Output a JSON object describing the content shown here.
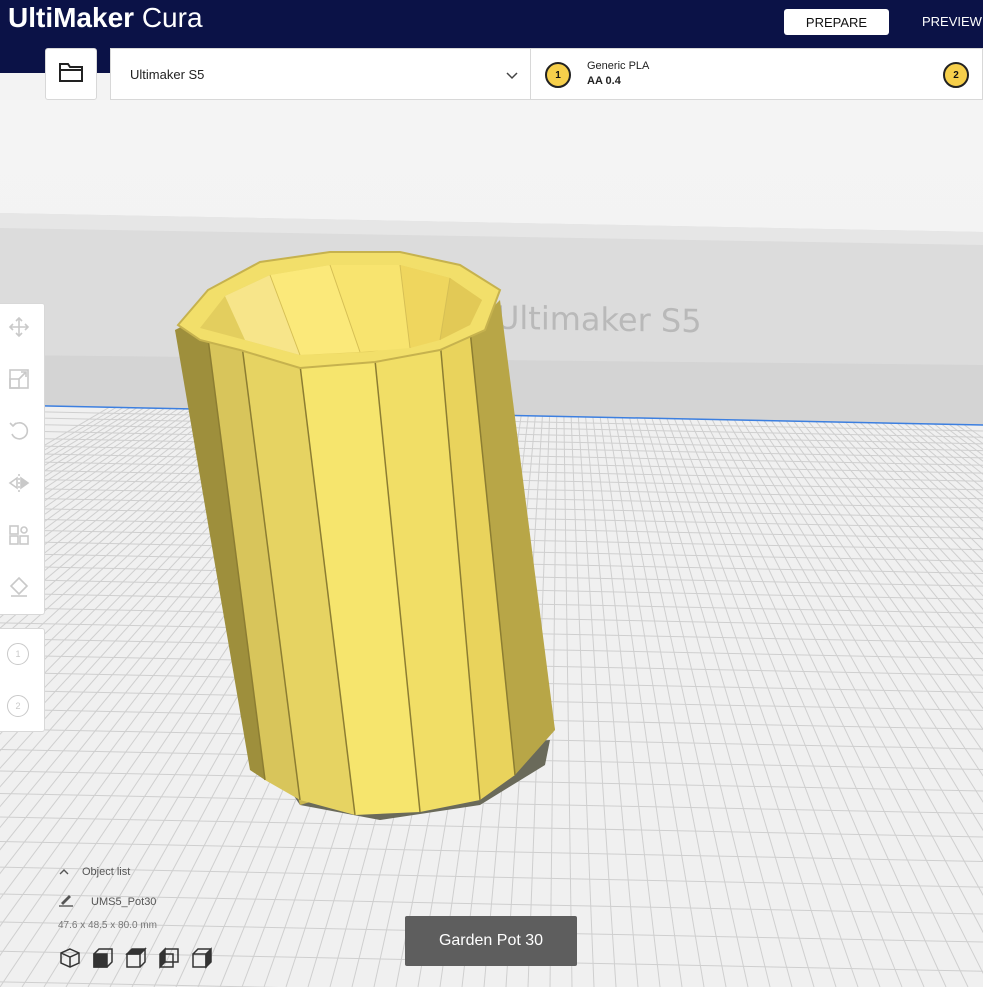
{
  "app": {
    "brand": "UltiMaker",
    "product": "Cura",
    "stages": {
      "prepare": "PREPARE",
      "preview": "PREVIEW"
    }
  },
  "toolbar": {
    "open_icon": "folder-icon",
    "machine": "Ultimaker S5",
    "extruder1_number": "1",
    "material": "Generic PLA",
    "nozzle": "AA 0.4",
    "extruder2_number": "2"
  },
  "scene": {
    "volume_label": "Ultimaker S5",
    "object_color": "#f7e36a"
  },
  "tools": [
    {
      "name": "move",
      "icon": "move-icon"
    },
    {
      "name": "scale",
      "icon": "scale-icon"
    },
    {
      "name": "rotate",
      "icon": "rotate-icon"
    },
    {
      "name": "mirror",
      "icon": "mirror-icon"
    },
    {
      "name": "per-model-settings",
      "icon": "per-model-settings-icon"
    },
    {
      "name": "support-blocker",
      "icon": "support-blocker-icon"
    }
  ],
  "extruders": [
    "1",
    "2"
  ],
  "object_list": {
    "label": "Object list",
    "object_name": "UMS5_Pot30",
    "dimensions": "47.6 x 48.5 x 80.0 mm"
  },
  "view_buttons": [
    "3d-view",
    "front-view",
    "top-view",
    "left-view",
    "right-view"
  ],
  "job_name": "Garden Pot 30"
}
